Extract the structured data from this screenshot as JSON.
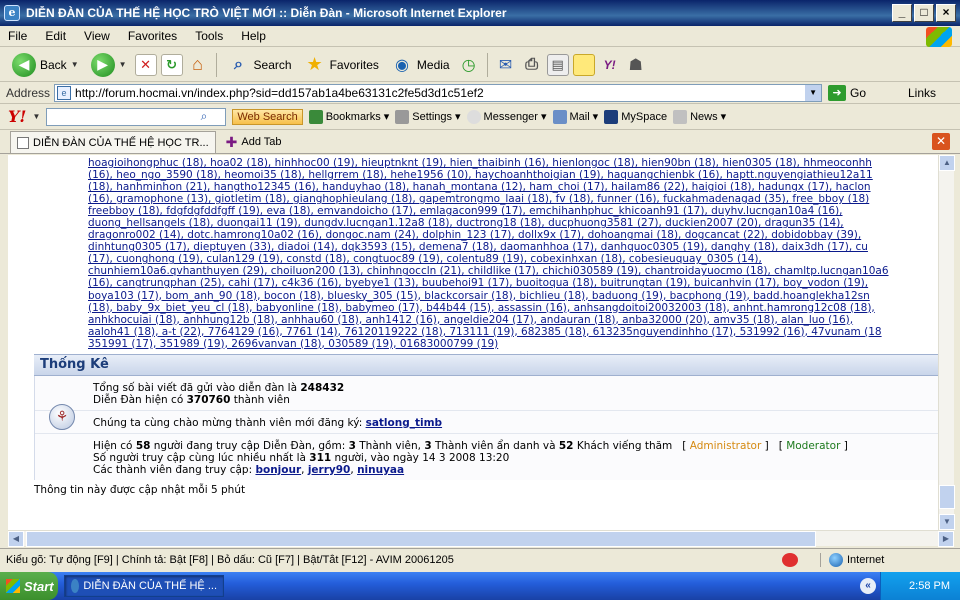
{
  "window": {
    "title": "DIỄN ĐÀN CỦA THẾ HỆ HỌC TRÒ VIỆT MỚI :: Diễn Đàn - Microsoft Internet Explorer",
    "buttons": {
      "minimize": "_",
      "maximize": "□",
      "close": "×"
    }
  },
  "menu": [
    "File",
    "Edit",
    "View",
    "Favorites",
    "Tools",
    "Help"
  ],
  "toolbar": {
    "back": "Back",
    "search": "Search",
    "favorites": "Favorites",
    "media": "Media"
  },
  "address": {
    "label": "Address",
    "url": "http://forum.hocmai.vn/index.php?sid=dd157ab1a4be63131c2fe5d3d1c51ef2",
    "go": "Go",
    "links": "Links"
  },
  "yahoo": {
    "web_search": "Web Search",
    "bookmarks": "Bookmarks",
    "settings": "Settings",
    "messenger": "Messenger",
    "mail": "Mail",
    "myspace": "MySpace",
    "news": "News"
  },
  "tabs": {
    "active": "DIỄN ĐÀN CỦA THẾ HỆ HỌC TR...",
    "add": "Add Tab"
  },
  "users": [
    "hoagioihongphuc (18), hoa02 (18), hinhhoc00 (19), hieuptnknt (19), hien_thaibinh (16), hienlongoc (18), hien90bn (18), hien0305 (18), hhmeoconhh",
    "(16), heo_ngo_3590 (18), heomoi35 (18), hellgrrem (18), hehe1956 (10), haychoanhthoigian (19), haquangchienbk (16), haptt.nguyengiathieu12a11",
    "(18), hanhminhon (21), hangtho12345 (16), handuyhao (18), hanah_montana (12), ham_choi (17), hailam86 (22), haigioi (18), hadungx (17), haclon",
    "(16), gramophone (13), giotletim (18), gianghophieulang (18), gapemtrongmo_laai (18), fv (18), funner (16), fuckahmadenagad (35), free_bboy (18)",
    "freebboy (18), fdgfdgfddfgff (19), eva (18), emvandoicho (17), emlagacon999 (17), emchihanhphuc_khicoanh91 (17), duyhv.lucngan10a4 (16),",
    "duong_hellsangels (18), duongai11 (19), dungdv.lucngan1.12a8 (18), ductrong18 (18), ducphuong3581 (27), duckien2007 (20), dragun35 (14),",
    "dragonro002 (14), dotc.hamrong10a02 (16), dongoc.nam (24), dolphin_123 (17), dollx9x (17), dohoangmai (18), dogcancat (22), dobidobbay (39),",
    "dinhtung0305 (17), dieptuyen (33), diadoi (14), dqk3593 (15), demena7 (18), daomanhhoa (17), danhquoc0305 (19), danghy (18), daix3dh (17), cu",
    "(17), cuonghong (19), culan129 (19), constd (18), congtuoc89 (19), colentu89 (19), cobexinhxan (18), cobesieuquay_0305 (14),",
    "chunhiem10a6.qvhanthuyen (29), choiluon200 (13), chinhngoccln (21), childlike (17), chichi030589 (19), chantroidayuocmo (18), chamltp.lucngan10a6",
    "(16), cangtrungphan (25), cahi (17), c4k36 (16), byebye1 (13), buubehoi91 (17), buoitoqua (18), buitrungtan (19), buicanhvin (17), boy_vodon (19),",
    "boya103 (17), bom_anh_90 (18), bocon (18), bluesky_305 (15), blackcorsair (18), bichlieu (18), baduong (19), bacphong (19), badd.hoanglekha12sn",
    "(18), baby_9x_biet_yeu_cl (18), babyonline (18), babymeo (17), b44b44 (15), assassin (16), anhsangdoitoi20032003 (18), anhnt.hamrong12c08 (18),",
    "anhkhocuiai (18), anhhung12b (18), anhhau60 (18), anh1412 (16), angeldie204 (17), andauran (18), anba32000 (20), amv35 (18), alan_luo (16),",
    "aaloh41 (18), a-t (22), 7764129 (16), 7761 (14), 76120119222 (18), 713111 (19), 682385 (18), 613235nguyendinhho (17), 531992 (16), 47vunam (18",
    "351991 (17), 351989 (19), 2696vanvan (18), 030589 (19), 01683000799 (19)"
  ],
  "stats": {
    "heading": "Thống Kê",
    "posts_prefix": "Tổng số bài viết đã gửi vào diễn đàn là ",
    "posts_count": "248432",
    "members_prefix": "Diễn Đàn hiện có ",
    "members_count": "370760",
    "members_suffix": " thành viên",
    "welcome_prefix": "Chúng ta cùng chào mừng thành viên mới đăng ký: ",
    "newest_member": "satlong_timb",
    "online_prefix": "Hiện có ",
    "online_count": "58",
    "online_mid1": " người đang truy cập Diễn Đàn, gồm: ",
    "online_members": "3",
    "online_mid2": " Thành viên, ",
    "online_hidden": "3",
    "online_mid3": " Thành viên ẩn danh và ",
    "online_guests": "52",
    "online_suffix": " Khách viếng thăm",
    "admin_label": "Administrator",
    "mod_label": "Moderator",
    "record_prefix": "Số người truy cập cùng lúc nhiều nhất là ",
    "record_count": "311",
    "record_suffix": " người, vào ngày 14 3 2008 13:20",
    "current_prefix": "Các thành viên đang truy cập: ",
    "current_1": "bonjour",
    "current_2": "jerry90",
    "current_3": "ninuyaa",
    "updated_note": "Thông tin này được cập nhật mỗi 5 phút"
  },
  "statusbar": {
    "text": "Kiểu gõ: Tự động [F9] | Chính tả: Bật [F8] | Bỏ dấu: Cũ [F7] | Bật/Tắt [F12] - AVIM 20061205",
    "zone": "Internet"
  },
  "taskbar": {
    "start": "Start",
    "item": "DIỄN ĐÀN CỦA THẾ HỆ ...",
    "clock": "2:58 PM",
    "tray_arrow": "«"
  },
  "colors": {
    "link": "#0b1a8c",
    "admin": "#d58a12",
    "moderator": "#1d7a1d",
    "stats_heading": "#1c3d7a"
  }
}
